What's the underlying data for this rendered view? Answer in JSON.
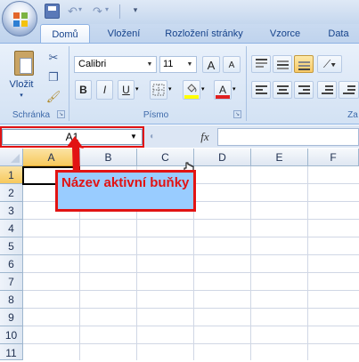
{
  "ribbon_tabs": [
    "Domů",
    "Vložení",
    "Rozložení stránky",
    "Vzorce",
    "Data"
  ],
  "clipboard": {
    "paste_label": "Vložit",
    "group_label": "Schránka"
  },
  "font": {
    "name": "Calibri",
    "size": "11",
    "bold": "B",
    "italic": "I",
    "underline": "U",
    "grow": "A",
    "shrink": "A",
    "font_color_letter": "A",
    "group_label": "Písmo"
  },
  "alignment": {
    "group_label": "Za"
  },
  "formula_bar": {
    "name_box_value": "A1",
    "fx": "fx"
  },
  "columns": [
    "A",
    "B",
    "C",
    "D",
    "E",
    "F"
  ],
  "rows": [
    "1",
    "2",
    "3",
    "4",
    "5",
    "6",
    "7",
    "8",
    "9",
    "10",
    "11"
  ],
  "active_cell": "A1",
  "annotation": {
    "text": "Název aktivní buňky",
    "border_color": "#e21313",
    "fill_color": "#99ccff"
  },
  "colors": {
    "ribbon_text": "#15428b",
    "highlight": "#f7c95d",
    "annotation_red": "#e21313"
  }
}
